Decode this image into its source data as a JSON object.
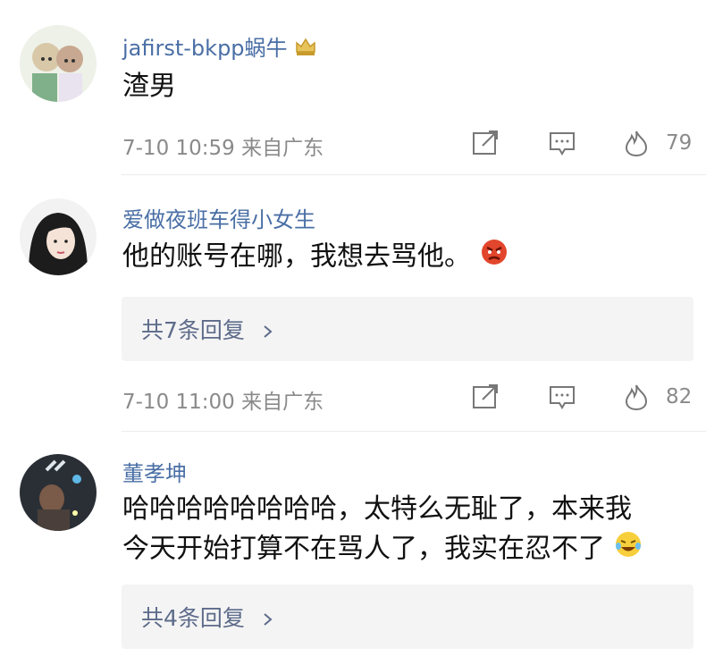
{
  "comments": [
    {
      "username": "jafirst-bkpp蜗牛",
      "text": "渣男",
      "time": "7-10 10:59",
      "location": "来自广东",
      "likes": "79",
      "username_color": "#4a6fa5"
    },
    {
      "username": "爱做夜班车得小女生",
      "text": "他的账号在哪，我想去骂他。",
      "replies": "共7条回复",
      "time": "7-10 11:00",
      "location": "来自广东",
      "likes": "82",
      "username_color": "#4a6fa5"
    },
    {
      "username": "董孝坤",
      "text_line1": "哈哈哈哈哈哈哈哈，太特么无耻了，本来我",
      "text_line2": "今天开始打算不在骂人了，我实在忍不了",
      "replies": "共4条回复",
      "username_color": "#4a6fa5"
    }
  ],
  "icons": {
    "share": "share-icon",
    "comment": "comment-icon",
    "like": "fire-like-icon",
    "badge": "crown-badge-icon",
    "chevron": "chevron-right-icon"
  },
  "colors": {
    "link": "#4a6fa5",
    "reply_text": "#5d6b8a",
    "meta": "#8a8a8a",
    "reply_bg": "#f4f4f4"
  }
}
